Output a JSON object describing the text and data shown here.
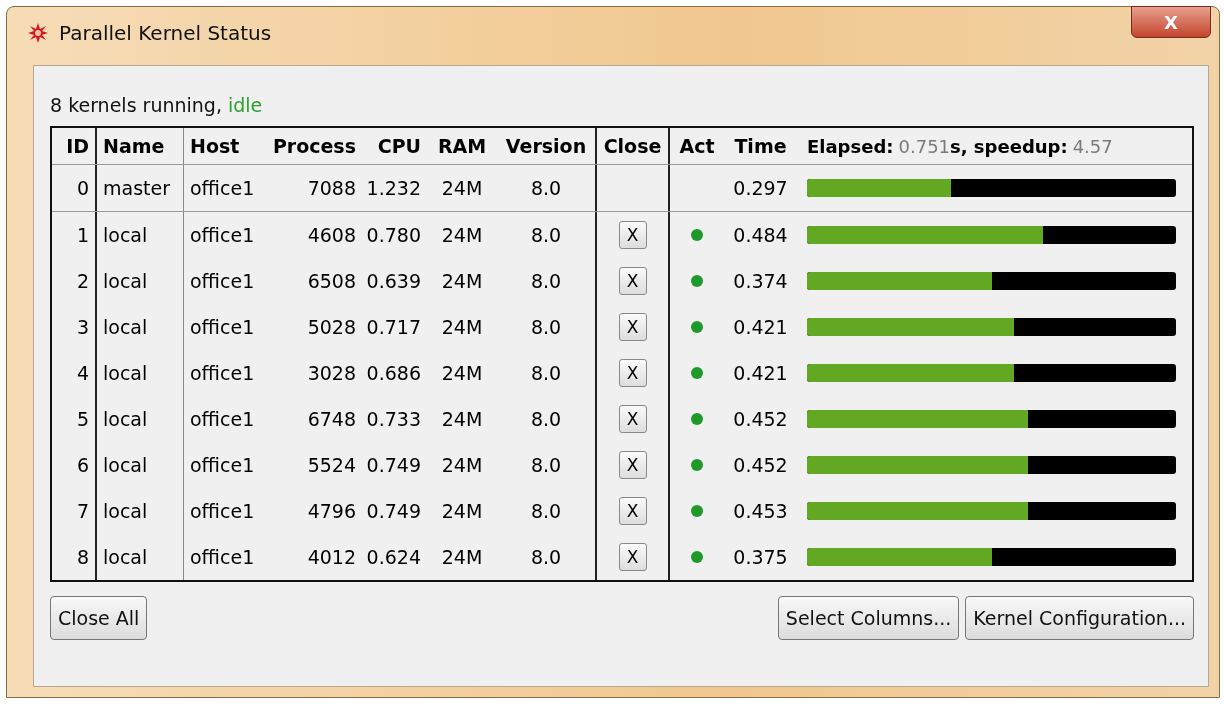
{
  "window": {
    "title": "Parallel Kernel Status",
    "close_label": "X"
  },
  "status": [
    {
      "text": "8 kernels running, ",
      "kind": "label"
    },
    {
      "text": "idle",
      "kind": "state"
    }
  ],
  "table": {
    "columns": [
      "ID",
      "Name",
      "Host",
      "Process",
      "CPU",
      "RAM",
      "Version",
      "Close",
      "Act",
      "Time"
    ],
    "summary": [
      {
        "text": "Elapsed:",
        "kind": "label"
      },
      {
        "text": "0.751",
        "kind": "value"
      },
      {
        "text": "s, speedup:",
        "kind": "label"
      },
      {
        "text": "4.57",
        "kind": "value"
      }
    ],
    "rows": [
      {
        "id": "0",
        "name": "master",
        "host": "office1",
        "process": "7088",
        "cpu": "1.232",
        "ram": "24M",
        "version": "8.0",
        "active": false,
        "time": "0.297",
        "level": 0.39
      },
      {
        "id": "1",
        "name": "local",
        "host": "office1",
        "process": "4608",
        "cpu": "0.780",
        "ram": "24M",
        "version": "8.0",
        "close": "X",
        "active": true,
        "time": "0.484",
        "level": 0.64
      },
      {
        "id": "2",
        "name": "local",
        "host": "office1",
        "process": "6508",
        "cpu": "0.639",
        "ram": "24M",
        "version": "8.0",
        "close": "X",
        "active": true,
        "time": "0.374",
        "level": 0.5
      },
      {
        "id": "3",
        "name": "local",
        "host": "office1",
        "process": "5028",
        "cpu": "0.717",
        "ram": "24M",
        "version": "8.0",
        "close": "X",
        "active": true,
        "time": "0.421",
        "level": 0.56
      },
      {
        "id": "4",
        "name": "local",
        "host": "office1",
        "process": "3028",
        "cpu": "0.686",
        "ram": "24M",
        "version": "8.0",
        "close": "X",
        "active": true,
        "time": "0.421",
        "level": 0.56
      },
      {
        "id": "5",
        "name": "local",
        "host": "office1",
        "process": "6748",
        "cpu": "0.733",
        "ram": "24M",
        "version": "8.0",
        "close": "X",
        "active": true,
        "time": "0.452",
        "level": 0.6
      },
      {
        "id": "6",
        "name": "local",
        "host": "office1",
        "process": "5524",
        "cpu": "0.749",
        "ram": "24M",
        "version": "8.0",
        "close": "X",
        "active": true,
        "time": "0.452",
        "level": 0.6
      },
      {
        "id": "7",
        "name": "local",
        "host": "office1",
        "process": "4796",
        "cpu": "0.749",
        "ram": "24M",
        "version": "8.0",
        "close": "X",
        "active": true,
        "time": "0.453",
        "level": 0.6
      },
      {
        "id": "8",
        "name": "local",
        "host": "office1",
        "process": "4012",
        "cpu": "0.624",
        "ram": "24M",
        "version": "8.0",
        "close": "X",
        "active": true,
        "time": "0.375",
        "level": 0.5
      }
    ]
  },
  "buttons": {
    "left": [
      "Close All"
    ],
    "right": [
      "Select Columns...",
      "Kernel Configuration..."
    ]
  }
}
